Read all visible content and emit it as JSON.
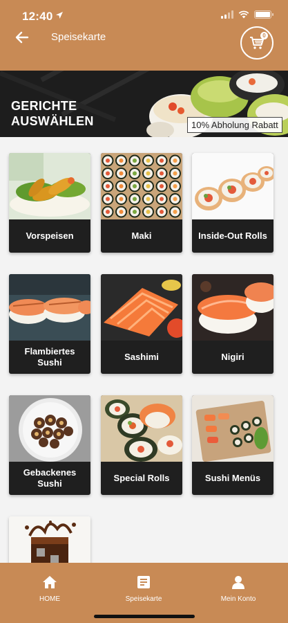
{
  "status": {
    "time": "12:40"
  },
  "header": {
    "title": "Speisekarte",
    "cart_count": "0"
  },
  "banner": {
    "title_line1": "GERICHTE",
    "title_line2": "AUSWÄHLEN",
    "badge": "10% Abholung Rabatt"
  },
  "categories": [
    {
      "label": "Vorspeisen"
    },
    {
      "label": "Maki"
    },
    {
      "label": "Inside-Out Rolls"
    },
    {
      "label": "Flambiertes Sushi"
    },
    {
      "label": "Sashimi"
    },
    {
      "label": "Nigiri"
    },
    {
      "label": "Gebackenes Sushi"
    },
    {
      "label": "Special Rolls"
    },
    {
      "label": "Sushi Menüs"
    },
    {
      "label": ""
    }
  ],
  "nav": {
    "home": "HOME",
    "menu": "Speisekarte",
    "account": "Mein Konto"
  },
  "colors": {
    "brand": "#c88a55",
    "card": "#1f1f1f"
  }
}
